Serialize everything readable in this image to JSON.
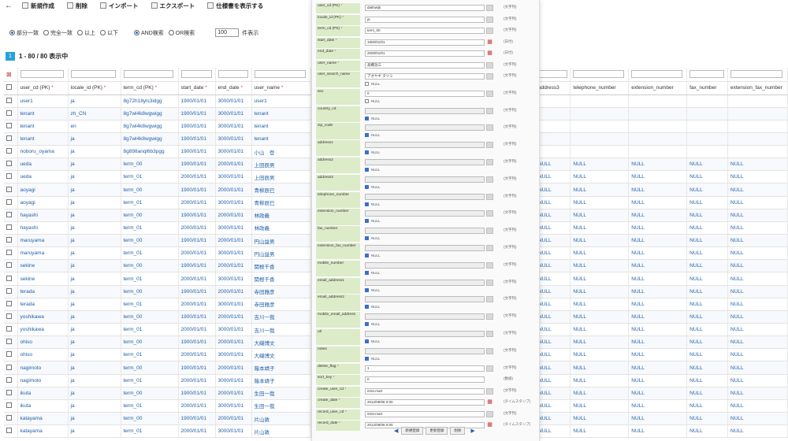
{
  "toolbar": {
    "back_icon": "arrow-left-icon",
    "items": [
      {
        "label": "新規作成",
        "icon": "new-file-icon"
      },
      {
        "label": "削除",
        "icon": "delete-icon"
      },
      {
        "label": "インポート",
        "icon": "import-icon"
      },
      {
        "label": "エクスポート",
        "icon": "export-icon"
      },
      {
        "label": "仕様書を表示する",
        "icon": "spec-icon"
      }
    ]
  },
  "search": {
    "match_options": [
      "部分一致",
      "完全一致",
      "以上",
      "以下"
    ],
    "logic_options": [
      "AND検索",
      "OR検索"
    ],
    "limit_value": "100",
    "limit_suffix": "件表示"
  },
  "result": {
    "page": "1",
    "count_text": "1 - 80 / 80 表示中"
  },
  "table": {
    "columns": [
      "user_cd (PK)",
      "locale_id (PK)",
      "term_cd (PK)",
      "start_date",
      "end_date",
      "user_name"
    ],
    "required_mark": "*",
    "rows": [
      [
        "user1",
        "ja",
        "8g72h18yls3idgg",
        "1900/01/01",
        "3000/01/01",
        "user1"
      ],
      [
        "tenant",
        "zh_CN",
        "8g7wl4k8wgwigg",
        "1900/01/01",
        "3000/01/01",
        "tenant"
      ],
      [
        "tenant",
        "en",
        "8g7wl4k8wgwigg",
        "1900/01/01",
        "3000/01/01",
        "tenant"
      ],
      [
        "tenant",
        "ja",
        "8g7wl4k8wgwigg",
        "1900/01/01",
        "3000/01/01",
        "tenant"
      ],
      [
        "noboru_oyama",
        "ja",
        "8g898anql6b3pgg",
        "1900/01/01",
        "3000/01/01",
        "小山　登"
      ],
      [
        "ueda",
        "ja",
        "term_00",
        "1900/01/01",
        "2000/01/01",
        "上田辰男"
      ],
      [
        "ueda",
        "ja",
        "term_01",
        "2000/01/01",
        "3000/01/01",
        "上田辰男"
      ],
      [
        "aoyagi",
        "ja",
        "term_00",
        "1900/01/01",
        "2000/01/01",
        "青柳辰巳"
      ],
      [
        "aoyagi",
        "ja",
        "term_01",
        "2000/01/01",
        "3000/01/01",
        "青柳辰巳"
      ],
      [
        "hayashi",
        "ja",
        "term_00",
        "1900/01/01",
        "2000/01/01",
        "林政義"
      ],
      [
        "hayashi",
        "ja",
        "term_01",
        "2000/01/01",
        "3000/01/01",
        "林政義"
      ],
      [
        "maruyama",
        "ja",
        "term_00",
        "1900/01/01",
        "2000/01/01",
        "円山益男"
      ],
      [
        "maruyama",
        "ja",
        "term_01",
        "2000/01/01",
        "3000/01/01",
        "円山益男"
      ],
      [
        "sekine",
        "ja",
        "term_00",
        "1900/01/01",
        "2000/01/01",
        "関根千香"
      ],
      [
        "sekine",
        "ja",
        "term_01",
        "2000/01/01",
        "3000/01/01",
        "関根千香"
      ],
      [
        "terada",
        "ja",
        "term_00",
        "1900/01/01",
        "2000/01/01",
        "寺田雅彦"
      ],
      [
        "terada",
        "ja",
        "term_01",
        "2000/01/01",
        "3000/01/01",
        "寺田雅彦"
      ],
      [
        "yoshikawa",
        "ja",
        "term_00",
        "1900/01/01",
        "2000/01/01",
        "吉川一我"
      ],
      [
        "yoshikawa",
        "ja",
        "term_01",
        "2000/01/01",
        "3000/01/01",
        "吉川一我"
      ],
      [
        "ohiso",
        "ja",
        "term_00",
        "1900/01/01",
        "2000/01/01",
        "大磯博文"
      ],
      [
        "ohiso",
        "ja",
        "term_01",
        "2000/01/01",
        "3000/01/01",
        "大磯博文"
      ],
      [
        "nagimoto",
        "ja",
        "term_00",
        "1900/01/01",
        "2000/01/01",
        "薙本靖子"
      ],
      [
        "nagimoto",
        "ja",
        "term_01",
        "2000/01/01",
        "3000/01/01",
        "薙本靖子"
      ],
      [
        "ikuta",
        "ja",
        "term_00",
        "1900/01/01",
        "2000/01/01",
        "生田一我"
      ],
      [
        "ikuta",
        "ja",
        "term_01",
        "2000/01/01",
        "3000/01/01",
        "生田一我"
      ],
      [
        "katayama",
        "ja",
        "term_00",
        "1900/01/01",
        "2000/01/01",
        "片山敦"
      ],
      [
        "katayama",
        "ja",
        "term_01",
        "2000/01/01",
        "3000/01/01",
        "片山敦"
      ]
    ]
  },
  "table_right": {
    "columns": [
      "address3",
      "telephone_number",
      "extension_number",
      "fax_number",
      "extension_fax_number"
    ],
    "null_text": "NULL",
    "blank_rows": 5,
    "null_rows": 22
  },
  "detail": {
    "null_label": "NULL",
    "fields": [
      {
        "label": "user_cd (PK)",
        "req": true,
        "value": "dakhwijk",
        "type": "(文字列)",
        "ctrl": "sel"
      },
      {
        "label": "locale_id (PK)",
        "req": true,
        "value": "ja",
        "type": "(文字列)",
        "ctrl": "sel"
      },
      {
        "label": "term_cd (PK)",
        "req": true,
        "value": "term_00",
        "type": "(文字列)",
        "ctrl": "sel"
      },
      {
        "label": "start_date",
        "req": true,
        "value": "1900/01/01",
        "type": "(日付)",
        "ctrl": "cal"
      },
      {
        "label": "end_date",
        "req": true,
        "value": "2000/01/01",
        "type": "(日付)",
        "ctrl": "cal"
      },
      {
        "label": "user_name",
        "req": true,
        "value": "高橋功三",
        "type": "(文字列)",
        "ctrl": "sel"
      },
      {
        "label": "user_search_name",
        "req": false,
        "value": "アオヤギ タツミ",
        "type": "(文字列)",
        "ctrl": "sel",
        "null": false
      },
      {
        "label": "sex",
        "req": false,
        "value": "0",
        "type": "(文字列)",
        "ctrl": "sel",
        "null": false
      },
      {
        "label": "country_cd",
        "req": false,
        "value": "",
        "type": "(文字列)",
        "ctrl": "sel",
        "null": true
      },
      {
        "label": "zip_code",
        "req": false,
        "value": "",
        "type": "(文字列)",
        "ctrl": "sel",
        "null": true
      },
      {
        "label": "address1",
        "req": false,
        "value": "",
        "type": "(文字列)",
        "ctrl": "sel",
        "null": true
      },
      {
        "label": "address2",
        "req": false,
        "value": "",
        "type": "(文字列)",
        "ctrl": "sel",
        "null": true
      },
      {
        "label": "address3",
        "req": false,
        "value": "",
        "type": "(文字列)",
        "ctrl": "sel",
        "null": true
      },
      {
        "label": "telephone_number",
        "req": false,
        "value": "",
        "type": "(文字列)",
        "ctrl": "sel",
        "null": true
      },
      {
        "label": "extension_number",
        "req": false,
        "value": "",
        "type": "(文字列)",
        "ctrl": "sel",
        "null": true
      },
      {
        "label": "fax_number",
        "req": false,
        "value": "",
        "type": "(文字列)",
        "ctrl": "sel",
        "null": true
      },
      {
        "label": "extension_fax_number",
        "req": false,
        "value": "",
        "type": "(文字列)",
        "ctrl": "sel",
        "null": true
      },
      {
        "label": "mobile_number",
        "req": false,
        "value": "",
        "type": "(文字列)",
        "ctrl": "sel",
        "null": true
      },
      {
        "label": "email_address1",
        "req": false,
        "value": "",
        "type": "(文字列)",
        "ctrl": "sel",
        "null": true
      },
      {
        "label": "email_address2",
        "req": false,
        "value": "",
        "type": "(文字列)",
        "ctrl": "sel",
        "null": true
      },
      {
        "label": "mobile_email_address",
        "req": false,
        "value": "",
        "type": "(文字列)",
        "ctrl": "sel",
        "null": true
      },
      {
        "label": "url",
        "req": false,
        "value": "",
        "type": "(文字列)",
        "ctrl": "sel",
        "null": true
      },
      {
        "label": "notes",
        "req": false,
        "value": "",
        "type": "(文字列)",
        "ctrl": "sel",
        "null": true
      },
      {
        "label": "delete_flag",
        "req": true,
        "value": "1",
        "type": "(文字列)",
        "ctrl": "sel"
      },
      {
        "label": "sort_key",
        "req": true,
        "value": "0",
        "type": "(数値)",
        "ctrl": "none"
      },
      {
        "label": "create_user_cd",
        "req": true,
        "value": "intra-mart",
        "type": "(文字列)",
        "ctrl": "sel"
      },
      {
        "label": "create_date",
        "req": true,
        "value": "2012/09/08 0:00",
        "type": "(タイムスタンプ)",
        "ctrl": "cal"
      },
      {
        "label": "record_user_cd",
        "req": true,
        "value": "intra-mart",
        "type": "(文字列)",
        "ctrl": "sel"
      },
      {
        "label": "record_date",
        "req": true,
        "value": "2012/09/08 0:00",
        "type": "(タイムスタンプ)",
        "ctrl": "cal"
      }
    ],
    "buttons": [
      "新規登録",
      "更新登録",
      "削除"
    ]
  }
}
